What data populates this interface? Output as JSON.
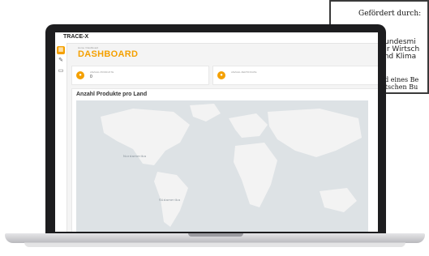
{
  "app": {
    "brand": "TRACE-X",
    "breadcrumb": "Home / Dashboard",
    "page_title": "DASHBOARD",
    "accent_color": "#f4a000"
  },
  "sidebar": {
    "items": [
      {
        "icon": "dashboard-icon",
        "glyph": "▦",
        "active": true
      },
      {
        "icon": "wrench-icon",
        "glyph": "🔧",
        "active": false
      },
      {
        "icon": "folder-icon",
        "glyph": "▭",
        "active": false
      }
    ]
  },
  "cards": [
    {
      "label": "ANZAHL PRODUKTE",
      "value": "0",
      "icon": "car-icon",
      "glyph": "🚗"
    },
    {
      "label": "ANZAHL ZERTIFIKATE",
      "value": "",
      "icon": "car-icon",
      "glyph": "🚗"
    }
  ],
  "map_panel": {
    "title": "Anzahl Produkte pro Land",
    "labels": [
      "Nordamerika",
      "Südamerika"
    ]
  },
  "notice": {
    "head": "Gefördert durch:",
    "ministry_line1": "Bundesmi",
    "ministry_line2": "für Wirtsch",
    "ministry_line3": "und Klima",
    "foot_line1": "aufgrund eines Be",
    "foot_line2": "des Deutschen Bu"
  }
}
